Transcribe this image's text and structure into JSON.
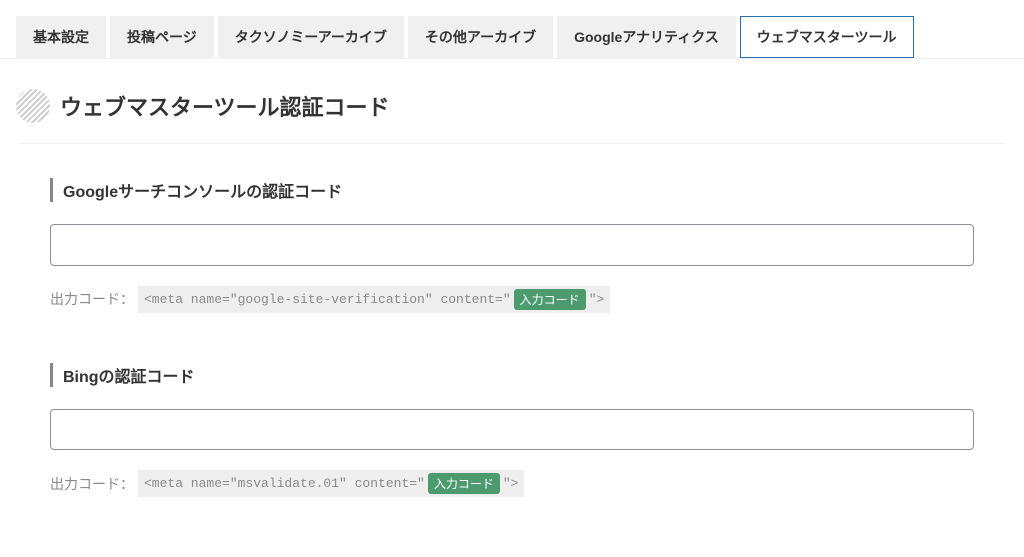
{
  "tabs": {
    "t0": "基本設定",
    "t1": "投稿ページ",
    "t2": "タクソノミーアーカイブ",
    "t3": "その他アーカイブ",
    "t4": "Googleアナリティクス",
    "t5": "ウェブマスターツール"
  },
  "section": {
    "title": "ウェブマスターツール認証コード"
  },
  "google": {
    "heading": "Googleサーチコンソールの認証コード",
    "value": "",
    "output_label": "出力コード：",
    "code_pre": "<meta name=\"google-site-verification\" content=\"",
    "badge": "入力コード",
    "code_post": "\">"
  },
  "bing": {
    "heading": "Bingの認証コード",
    "value": "",
    "output_label": "出力コード：",
    "code_pre": "<meta name=\"msvalidate.01\" content=\"",
    "badge": "入力コード",
    "code_post": "\">"
  }
}
